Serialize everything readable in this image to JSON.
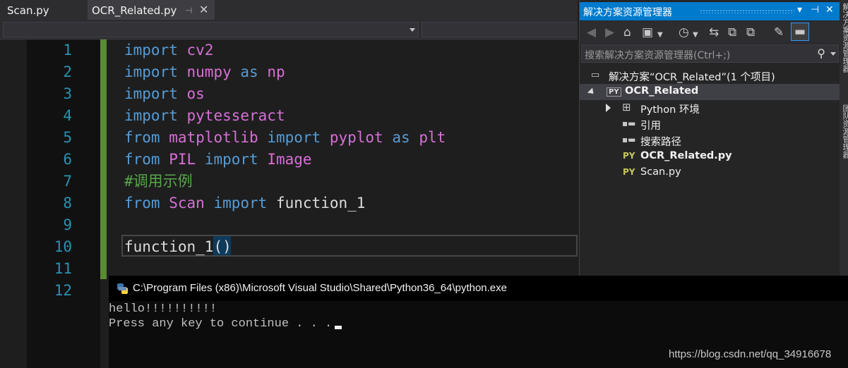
{
  "tabs": [
    {
      "label": "Scan.py",
      "active": false
    },
    {
      "label": "OCR_Related.py",
      "active": true
    }
  ],
  "tab_pin_icon": "pin-icon",
  "tab_close_icon": "close-icon",
  "editor": {
    "line_numbers": [
      "1",
      "2",
      "3",
      "4",
      "5",
      "6",
      "7",
      "8",
      "9",
      "10",
      "11",
      "12"
    ],
    "lines": [
      [
        {
          "t": "import",
          "c": "kw"
        },
        {
          "t": " ",
          "c": "plain"
        },
        {
          "t": "cv2",
          "c": "mod"
        }
      ],
      [
        {
          "t": "import",
          "c": "kw"
        },
        {
          "t": " ",
          "c": "plain"
        },
        {
          "t": "numpy",
          "c": "mod"
        },
        {
          "t": " ",
          "c": "plain"
        },
        {
          "t": "as",
          "c": "kw"
        },
        {
          "t": " ",
          "c": "plain"
        },
        {
          "t": "np",
          "c": "mod"
        }
      ],
      [
        {
          "t": "import",
          "c": "kw"
        },
        {
          "t": " ",
          "c": "plain"
        },
        {
          "t": "os",
          "c": "mod"
        }
      ],
      [
        {
          "t": "import",
          "c": "kw"
        },
        {
          "t": " ",
          "c": "plain"
        },
        {
          "t": "pytesseract",
          "c": "mod"
        }
      ],
      [
        {
          "t": "from",
          "c": "kw"
        },
        {
          "t": " ",
          "c": "plain"
        },
        {
          "t": "matplotlib",
          "c": "mod"
        },
        {
          "t": " ",
          "c": "plain"
        },
        {
          "t": "import",
          "c": "kw"
        },
        {
          "t": " ",
          "c": "plain"
        },
        {
          "t": "pyplot",
          "c": "mod"
        },
        {
          "t": " ",
          "c": "plain"
        },
        {
          "t": "as",
          "c": "kw"
        },
        {
          "t": " ",
          "c": "plain"
        },
        {
          "t": "plt",
          "c": "mod"
        }
      ],
      [
        {
          "t": "from",
          "c": "kw"
        },
        {
          "t": " ",
          "c": "plain"
        },
        {
          "t": "PIL",
          "c": "mod"
        },
        {
          "t": " ",
          "c": "plain"
        },
        {
          "t": "import",
          "c": "kw"
        },
        {
          "t": " ",
          "c": "plain"
        },
        {
          "t": "Image",
          "c": "mod"
        }
      ],
      [
        {
          "t": "#调用示例",
          "c": "cmt"
        }
      ],
      [
        {
          "t": "from",
          "c": "kw"
        },
        {
          "t": " ",
          "c": "plain"
        },
        {
          "t": "Scan",
          "c": "mod"
        },
        {
          "t": " ",
          "c": "plain"
        },
        {
          "t": "import",
          "c": "kw"
        },
        {
          "t": " ",
          "c": "plain"
        },
        {
          "t": "function_1",
          "c": "plain"
        }
      ],
      [],
      [
        {
          "t": "function_1",
          "c": "plain"
        },
        {
          "t": "()",
          "c": "paren"
        }
      ],
      [],
      []
    ]
  },
  "console": {
    "title": "C:\\Program Files (x86)\\Microsoft Visual Studio\\Shared\\Python36_64\\python.exe",
    "icon": "python-icon",
    "lines": [
      "hello!!!!!!!!!!",
      "Press any key to continue . . . "
    ]
  },
  "watermark": "https://blog.csdn.net/qq_34916678",
  "solution_explorer": {
    "title": "解决方案资源管理器",
    "title_buttons": [
      "▾",
      "⊣",
      "✕"
    ],
    "search_placeholder": "搜索解决方案资源管理器(Ctrl+;)",
    "toolbar_icons": [
      "back-icon",
      "forward-icon",
      "home-icon",
      "switch-views-icon",
      "dropdown-icon",
      "history-icon",
      "sync-icon",
      "collapse-all-icon",
      "show-all-files-icon",
      "properties-icon",
      "preview-icon"
    ],
    "tree": [
      {
        "label": "解决方案“OCR_Related”(1 个项目)",
        "icon": "solution-icon",
        "bold": false
      },
      {
        "label": "OCR_Related",
        "icon": "python-project-icon",
        "bold": true
      },
      {
        "label": "Python 环境",
        "icon": "environment-icon",
        "bold": false
      },
      {
        "label": "引用",
        "icon": "references-icon",
        "bold": false
      },
      {
        "label": "搜索路径",
        "icon": "search-paths-icon",
        "bold": false
      },
      {
        "label": "OCR_Related.py",
        "icon": "python-file-icon",
        "bold": true
      },
      {
        "label": "Scan.py",
        "icon": "python-file-icon",
        "bold": false
      }
    ]
  },
  "side_panels": [
    "解决方案资源管理器",
    "团队资源管理器"
  ]
}
